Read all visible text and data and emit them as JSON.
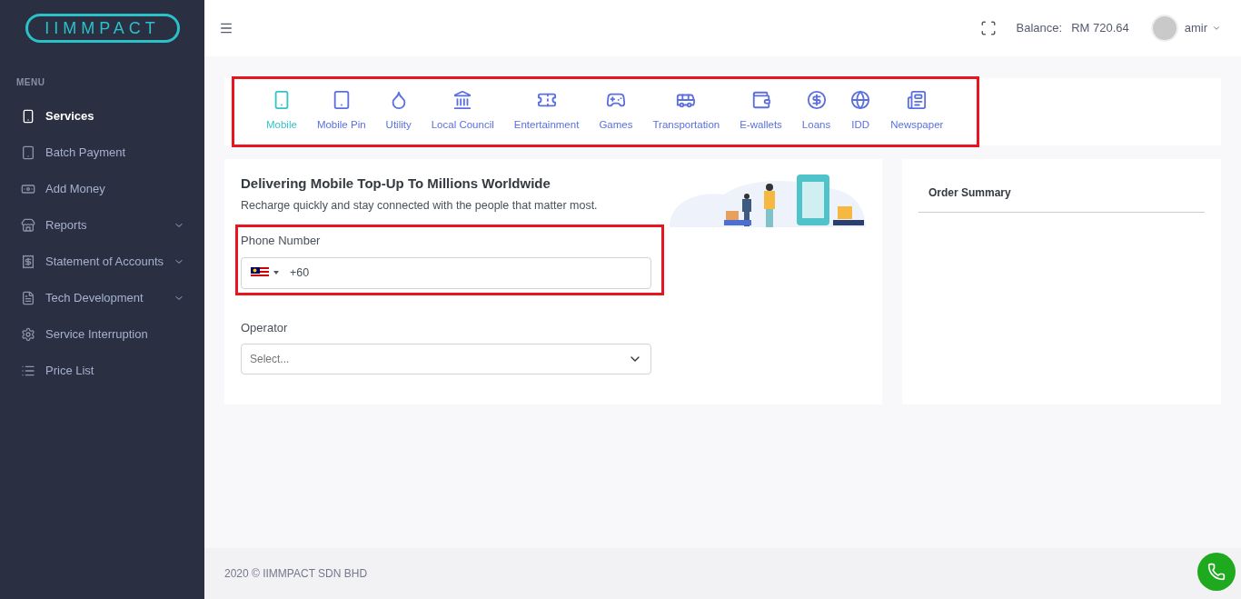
{
  "logo": {
    "text": "IIMMPACT"
  },
  "sidebar": {
    "heading": "MENU",
    "items": [
      {
        "label": "Services",
        "selected": true,
        "expandable": false
      },
      {
        "label": "Batch Payment",
        "selected": false,
        "expandable": false
      },
      {
        "label": "Add Money",
        "selected": false,
        "expandable": false
      },
      {
        "label": "Reports",
        "selected": false,
        "expandable": true
      },
      {
        "label": "Statement of Accounts",
        "selected": false,
        "expandable": true
      },
      {
        "label": "Tech Development",
        "selected": false,
        "expandable": true
      },
      {
        "label": "Service Interruption",
        "selected": false,
        "expandable": false
      },
      {
        "label": "Price List",
        "selected": false,
        "expandable": false
      }
    ]
  },
  "header": {
    "balance_label": "Balance:",
    "balance": "RM 720.64",
    "user": "amir"
  },
  "services": [
    {
      "label": "Mobile",
      "selected": true
    },
    {
      "label": "Mobile Pin",
      "selected": false
    },
    {
      "label": "Utility",
      "selected": false
    },
    {
      "label": "Local Council",
      "selected": false
    },
    {
      "label": "Entertainment",
      "selected": false
    },
    {
      "label": "Games",
      "selected": false
    },
    {
      "label": "Transportation",
      "selected": false
    },
    {
      "label": "E-wallets",
      "selected": false
    },
    {
      "label": "Loans",
      "selected": false
    },
    {
      "label": "IDD",
      "selected": false
    },
    {
      "label": "Newspaper",
      "selected": false
    }
  ],
  "form": {
    "title": "Delivering Mobile Top-Up To Millions Worldwide",
    "subtitle": "Recharge quickly and stay connected with the people that matter most.",
    "phone_label": "Phone Number",
    "phone_value": "+60",
    "operator_label": "Operator",
    "operator_placeholder": "Select..."
  },
  "order_summary": {
    "title": "Order Summary"
  },
  "footer": {
    "text": "2020 © IIMMPACT SDN BHD"
  }
}
